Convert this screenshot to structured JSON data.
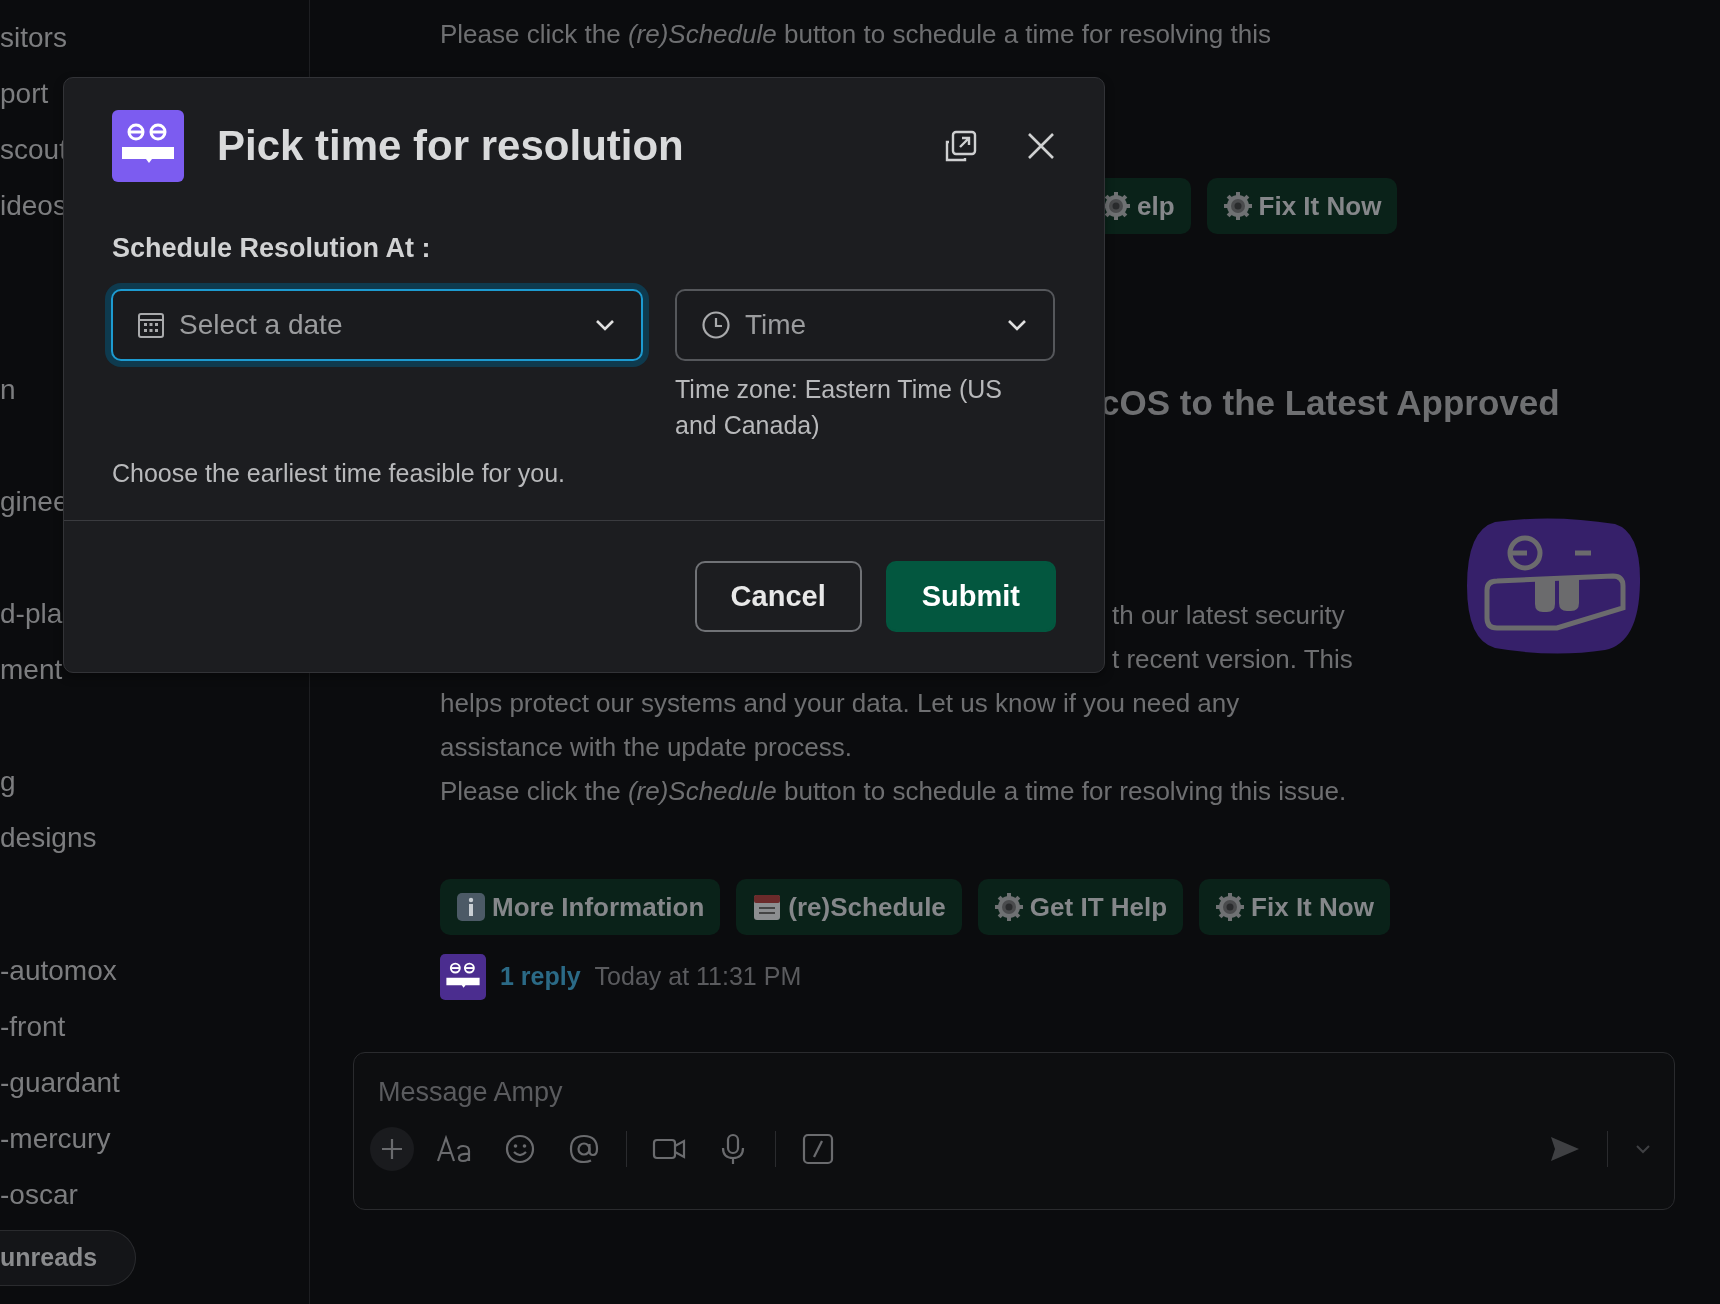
{
  "sidebar": {
    "sections": [
      {
        "items": [
          "sitors",
          "port",
          "scout",
          "ideos"
        ]
      },
      {
        "items": [
          "n"
        ]
      },
      {
        "items": [
          "ginee"
        ]
      },
      {
        "items": [
          "d-pla",
          "ment"
        ]
      },
      {
        "items": [
          "g",
          "designs"
        ]
      },
      {
        "items": [
          "-automox",
          "-front",
          "-guardant",
          "-mercury",
          "-oscar"
        ]
      }
    ],
    "unreads_button": "unreads"
  },
  "message_top": {
    "text": "Please click the *(re)Schedule* button to schedule a time for resolving this",
    "actions": [
      {
        "label": "elp",
        "kind": "gear"
      },
      {
        "label": "Fix It Now",
        "kind": "gear"
      }
    ]
  },
  "message": {
    "heading": "cOS to the Latest Approved",
    "body_lines": [
      "th our latest security",
      "t recent version. This",
      "helps protect our systems and your data. Let us know if you need any",
      "assistance with the update process."
    ],
    "note": "Please click the *(re)Schedule* button to schedule a time for resolving this issue.",
    "actions": [
      {
        "label": "More Information",
        "kind": "info"
      },
      {
        "label": "(re)Schedule",
        "kind": "calendar"
      },
      {
        "label": "Get IT Help",
        "kind": "gear"
      },
      {
        "label": "Fix It Now",
        "kind": "gear"
      }
    ],
    "replies": "1 reply",
    "time": "Today at 11:31 PM"
  },
  "composer": {
    "placeholder": "Message Ampy"
  },
  "modal": {
    "title": "Pick time for resolution",
    "label": "Schedule Resolution At :",
    "date_field": {
      "placeholder": "Select a date",
      "focused": true
    },
    "time_field": {
      "placeholder": "Time",
      "focused": false
    },
    "timezone": "Time zone: Eastern Time (US and Canada)",
    "hint": "Choose the earliest time feasible for you.",
    "buttons": [
      {
        "label": "Cancel",
        "kind": "secondary"
      },
      {
        "label": "Submit",
        "kind": "primary"
      }
    ]
  }
}
